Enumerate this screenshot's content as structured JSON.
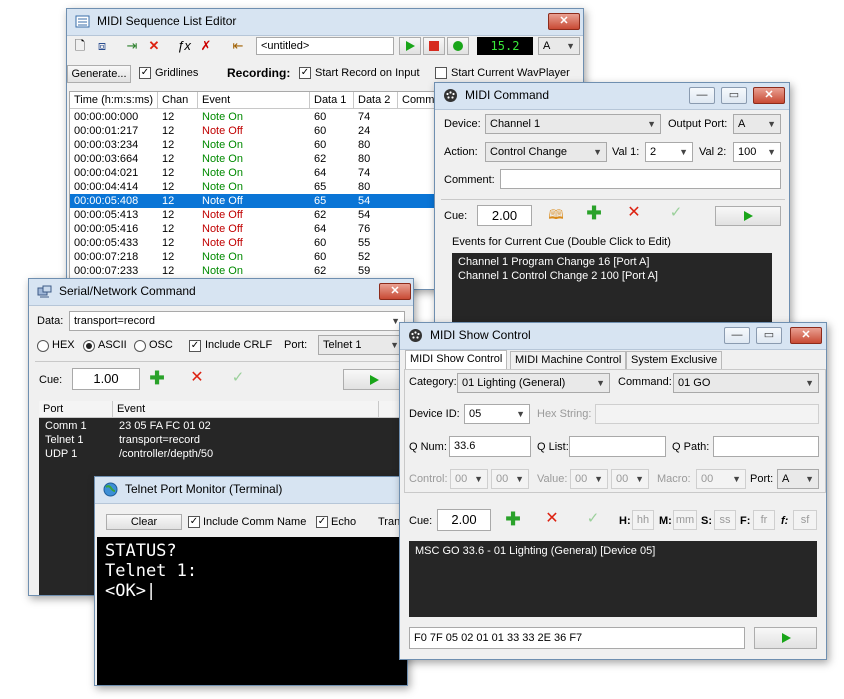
{
  "seq": {
    "title": "MIDI Sequence List Editor",
    "untitled": "<untitled>",
    "tempo": "15.2",
    "port": "A",
    "generate": "Generate...",
    "gridlines": "Gridlines",
    "recording": "Recording:",
    "start_record": "Start Record on Input",
    "start_wav": "Start Current WavPlayer",
    "columns": [
      "Time (h:m:s:ms)",
      "Chan",
      "Event",
      "Data 1",
      "Data 2",
      "Comm"
    ],
    "rows": [
      [
        "00:00:00:000",
        "12",
        "Note On",
        "60",
        "74"
      ],
      [
        "00:00:01:217",
        "12",
        "Note Off",
        "60",
        "24"
      ],
      [
        "00:00:03:234",
        "12",
        "Note On",
        "60",
        "80"
      ],
      [
        "00:00:03:664",
        "12",
        "Note On",
        "62",
        "80"
      ],
      [
        "00:00:04:021",
        "12",
        "Note On",
        "64",
        "74"
      ],
      [
        "00:00:04:414",
        "12",
        "Note On",
        "65",
        "80"
      ],
      [
        "00:00:05:408",
        "12",
        "Note Off",
        "65",
        "54"
      ],
      [
        "00:00:05:413",
        "12",
        "Note Off",
        "62",
        "54"
      ],
      [
        "00:00:05:416",
        "12",
        "Note Off",
        "64",
        "76"
      ],
      [
        "00:00:05:433",
        "12",
        "Note Off",
        "60",
        "55"
      ],
      [
        "00:00:07:218",
        "12",
        "Note On",
        "60",
        "52"
      ],
      [
        "00:00:07:233",
        "12",
        "Note On",
        "62",
        "59"
      ]
    ]
  },
  "cmd": {
    "title": "MIDI Command",
    "device_label": "Device:",
    "device": "Channel 1",
    "output_label": "Output Port:",
    "output": "A",
    "action_label": "Action:",
    "action": "Control Change",
    "val1_label": "Val 1:",
    "val1": "2",
    "val2_label": "Val 2:",
    "val2": "100",
    "comment_label": "Comment:",
    "cue_label": "Cue:",
    "cue": "2.00",
    "events_label": "Events for Current Cue (Double Click to Edit)",
    "events": [
      "Channel 1 Program Change 16 [Port A]",
      "Channel 1 Control Change 2 100 [Port A]"
    ]
  },
  "serial": {
    "title": "Serial/Network Command",
    "data_label": "Data:",
    "data": "transport=record",
    "hex": "HEX",
    "ascii": "ASCII",
    "osc": "OSC",
    "crlf": "Include CRLF",
    "port_label": "Port:",
    "port": "Telnet 1",
    "cue_label": "Cue:",
    "cue": "1.00",
    "columns": [
      "Port",
      "Event"
    ],
    "rows": [
      [
        "Comm 1",
        "23 05 FA FC 01 02"
      ],
      [
        "Telnet 1",
        "transport=record"
      ],
      [
        "UDP 1",
        "/controller/depth/50"
      ]
    ]
  },
  "telnet": {
    "title": "Telnet Port Monitor (Terminal)",
    "clear": "Clear",
    "include_comm": "Include Comm Name",
    "echo": "Echo",
    "tran": "Tran",
    "lines": [
      "STATUS?",
      "Telnet 1:",
      "<OK>"
    ]
  },
  "msc": {
    "title": "MIDI Show Control",
    "tabs": [
      "MIDI Show Control",
      "MIDI Machine Control",
      "System Exclusive"
    ],
    "category_label": "Category:",
    "category": "01  Lighting (General)",
    "command_label": "Command:",
    "command": "01  GO",
    "device_label": "Device ID:",
    "device": "05",
    "hex_label": "Hex String:",
    "qnum_label": "Q Num:",
    "qnum": "33.6",
    "qlist_label": "Q List:",
    "qpath_label": "Q Path:",
    "control_label": "Control:",
    "value_label": "Value:",
    "macro_label": "Macro:",
    "port_label": "Port:",
    "port": "A",
    "zero": "00",
    "cue_label": "Cue:",
    "cue": "2.00",
    "h": "H:",
    "hh": "hh",
    "m": "M:",
    "mm": "mm",
    "s": "S:",
    "ss": "ss",
    "f": "F:",
    "fr": "fr",
    "f2": "f:",
    "sf": "sf",
    "event": "MSC GO 33.6 - 01  Lighting (General)  [Device 05]",
    "sysex": "F0 7F 05 02 01 01 33 33 2E 36 F7"
  }
}
